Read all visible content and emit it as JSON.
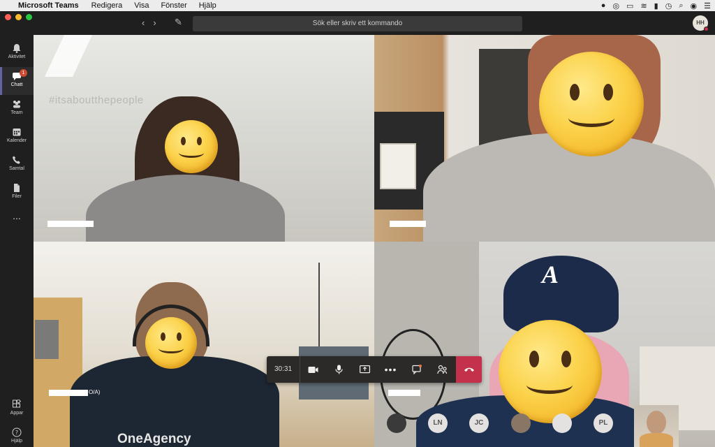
{
  "menubar": {
    "app_name": "Microsoft Teams",
    "items": [
      "Redigera",
      "Visa",
      "Fönster",
      "Hjälp"
    ]
  },
  "topbar": {
    "search_placeholder": "Sök eller skriv ett kommando",
    "user_initials": "HH"
  },
  "rail": {
    "items": [
      {
        "label": "Aktivitet",
        "icon": "bell-icon"
      },
      {
        "label": "Chatt",
        "icon": "chat-icon",
        "badge": "1",
        "active": true
      },
      {
        "label": "Team",
        "icon": "team-icon"
      },
      {
        "label": "Kalender",
        "icon": "calendar-icon"
      },
      {
        "label": "Samtal",
        "icon": "phone-icon"
      },
      {
        "label": "Filer",
        "icon": "file-icon"
      },
      {
        "label": "...",
        "icon": "more-icon"
      }
    ],
    "bottom": [
      {
        "label": "Appar",
        "icon": "apps-icon"
      },
      {
        "label": "Hjälp",
        "icon": "help-icon"
      }
    ]
  },
  "video": {
    "tile1_wall_text": "#itsaboutthepeople",
    "tile3_name_suffix": "O/A)",
    "tile3_shirt_text": "OneAgency"
  },
  "call": {
    "duration": "30:31"
  },
  "participants": [
    {
      "initials": "LN"
    },
    {
      "initials": "JC"
    },
    {
      "initials": "PL"
    }
  ],
  "colors": {
    "accent": "#6264a7",
    "hangup": "#c4314b",
    "badge": "#cc4a31"
  }
}
